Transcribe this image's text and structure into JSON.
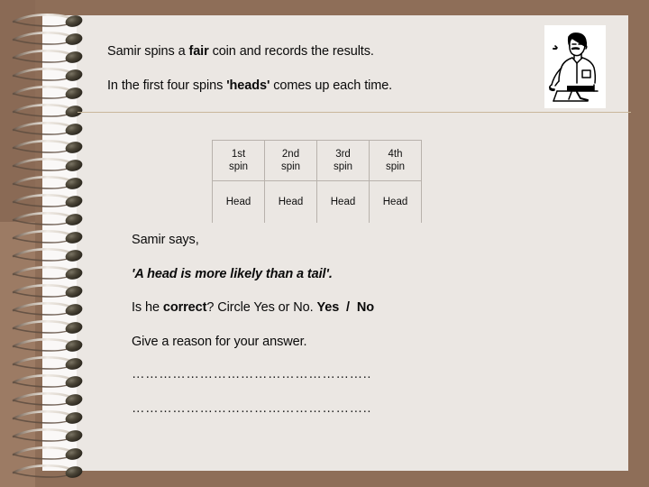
{
  "page": {
    "background_color": "#8E6E58",
    "paper_color": "#EBE7E3",
    "divider_color": "#C9B79B"
  },
  "header": {
    "line1_part1": "Samir spins a ",
    "line1_bold": "fair",
    "line1_part2": " coin and records the results.",
    "line2_part1": "In the first four spins ",
    "line2_bold": "'heads'",
    "line2_part2": " comes up each time."
  },
  "illustration": {
    "alt": "line drawing of a man tossing a coin at a table"
  },
  "table": {
    "headers": [
      {
        "l1": "1st",
        "l2": "spin"
      },
      {
        "l1": "2nd",
        "l2": "spin"
      },
      {
        "l1": "3rd",
        "l2": "spin"
      },
      {
        "l1": "4th",
        "l2": "spin"
      }
    ],
    "values": [
      "Head",
      "Head",
      "Head",
      "Head"
    ]
  },
  "question": {
    "says": "Samir says,",
    "quote": "'A head is more likely than a tail'.",
    "correct_part1": "Is he ",
    "correct_bold": "correct",
    "correct_part2": "? Circle Yes or No. ",
    "answer_yes": "Yes",
    "answer_slash": "/",
    "answer_no": "No",
    "reason": "Give a reason for your answer.",
    "dots_line1": "……………………………………………..",
    "dots_line2": "…………………………………………….."
  }
}
